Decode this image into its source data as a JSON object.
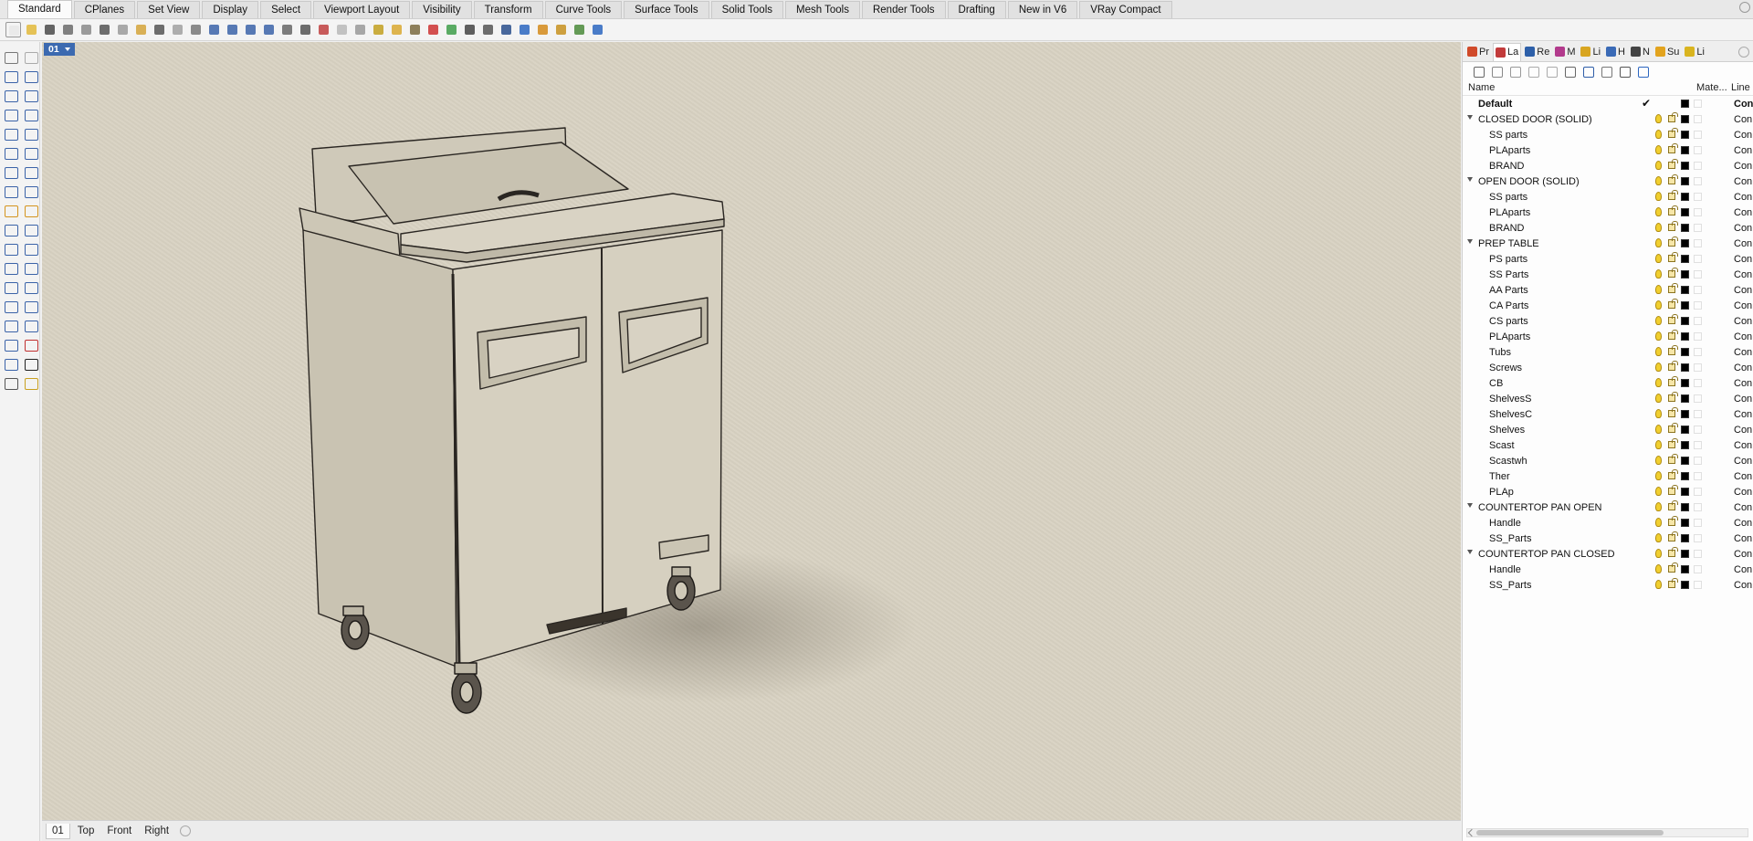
{
  "ribbon_tabs": [
    "Standard",
    "CPlanes",
    "Set View",
    "Display",
    "Select",
    "Viewport Layout",
    "Visibility",
    "Transform",
    "Curve Tools",
    "Surface Tools",
    "Solid Tools",
    "Mesh Tools",
    "Render Tools",
    "Drafting",
    "New in V6",
    "VRay Compact"
  ],
  "active_ribbon_tab": "Standard",
  "viewport": {
    "label": "01"
  },
  "viewport_tabs": [
    "01",
    "Top",
    "Front",
    "Right"
  ],
  "active_viewport_tab": "01",
  "panel_tabs": [
    {
      "label": "Pr",
      "icon": "properties-icon",
      "color": "#d04a2a"
    },
    {
      "label": "La",
      "icon": "layers-icon",
      "color": "#c23b3b"
    },
    {
      "label": "Re",
      "icon": "render-icon",
      "color": "#2d5fa8"
    },
    {
      "label": "M",
      "icon": "materials-icon",
      "color": "#b23a8c"
    },
    {
      "label": "Li",
      "icon": "libraries-icon",
      "color": "#d8a520"
    },
    {
      "label": "H",
      "icon": "help-icon",
      "color": "#3a6ab6"
    },
    {
      "label": "N",
      "icon": "named-views-icon",
      "color": "#444444"
    },
    {
      "label": "Su",
      "icon": "sun-icon",
      "color": "#e2a31e"
    },
    {
      "label": "Li",
      "icon": "lights-icon",
      "color": "#d9b41f"
    }
  ],
  "active_panel_tab": "La",
  "layer_table": {
    "headers": {
      "name": "Name",
      "material": "Mate...",
      "linetype": "Line"
    },
    "rows": [
      {
        "name": "Default",
        "level": "default",
        "current": true,
        "linetype": "Con"
      },
      {
        "name": "CLOSED DOOR (SOLID)",
        "level": "top",
        "linetype": "Con"
      },
      {
        "name": "SS parts",
        "level": "child",
        "linetype": "Con"
      },
      {
        "name": "PLAparts",
        "level": "child",
        "linetype": "Con"
      },
      {
        "name": "BRAND",
        "level": "child",
        "linetype": "Con"
      },
      {
        "name": "OPEN DOOR (SOLID)",
        "level": "top",
        "linetype": "Con"
      },
      {
        "name": "SS parts",
        "level": "child",
        "linetype": "Con"
      },
      {
        "name": "PLAparts",
        "level": "child",
        "linetype": "Con"
      },
      {
        "name": "BRAND",
        "level": "child",
        "linetype": "Con"
      },
      {
        "name": "PREP TABLE",
        "level": "top",
        "linetype": "Con"
      },
      {
        "name": "PS parts",
        "level": "child",
        "linetype": "Con"
      },
      {
        "name": "SS Parts",
        "level": "child",
        "linetype": "Con"
      },
      {
        "name": "AA Parts",
        "level": "child",
        "linetype": "Con"
      },
      {
        "name": "CA Parts",
        "level": "child",
        "linetype": "Con"
      },
      {
        "name": "CS parts",
        "level": "child",
        "linetype": "Con"
      },
      {
        "name": "PLAparts",
        "level": "child",
        "linetype": "Con"
      },
      {
        "name": "Tubs",
        "level": "child",
        "linetype": "Con"
      },
      {
        "name": "Screws",
        "level": "child",
        "linetype": "Con"
      },
      {
        "name": "CB",
        "level": "child",
        "linetype": "Con"
      },
      {
        "name": "ShelvesS",
        "level": "child",
        "linetype": "Con"
      },
      {
        "name": "ShelvesC",
        "level": "child",
        "linetype": "Con"
      },
      {
        "name": "Shelves",
        "level": "child",
        "linetype": "Con"
      },
      {
        "name": "Scast",
        "level": "child",
        "linetype": "Con"
      },
      {
        "name": "Scastwh",
        "level": "child",
        "linetype": "Con"
      },
      {
        "name": "Ther",
        "level": "child",
        "linetype": "Con"
      },
      {
        "name": "PLAp",
        "level": "child",
        "linetype": "Con"
      },
      {
        "name": "COUNTERTOP PAN OPEN",
        "level": "top",
        "linetype": "Con"
      },
      {
        "name": "Handle",
        "level": "child",
        "linetype": "Con"
      },
      {
        "name": "SS_Parts",
        "level": "child",
        "linetype": "Con"
      },
      {
        "name": "COUNTERTOP PAN CLOSED",
        "level": "top",
        "linetype": "Con"
      },
      {
        "name": "Handle",
        "level": "child",
        "linetype": "Con"
      },
      {
        "name": "SS_Parts",
        "level": "child",
        "linetype": "Con"
      }
    ]
  },
  "colors": {
    "viewport_background": "#d8d2c2",
    "viewport_label": "#3c6ab0",
    "layer_color": "#000000",
    "bulb": "#f1cf2f"
  }
}
